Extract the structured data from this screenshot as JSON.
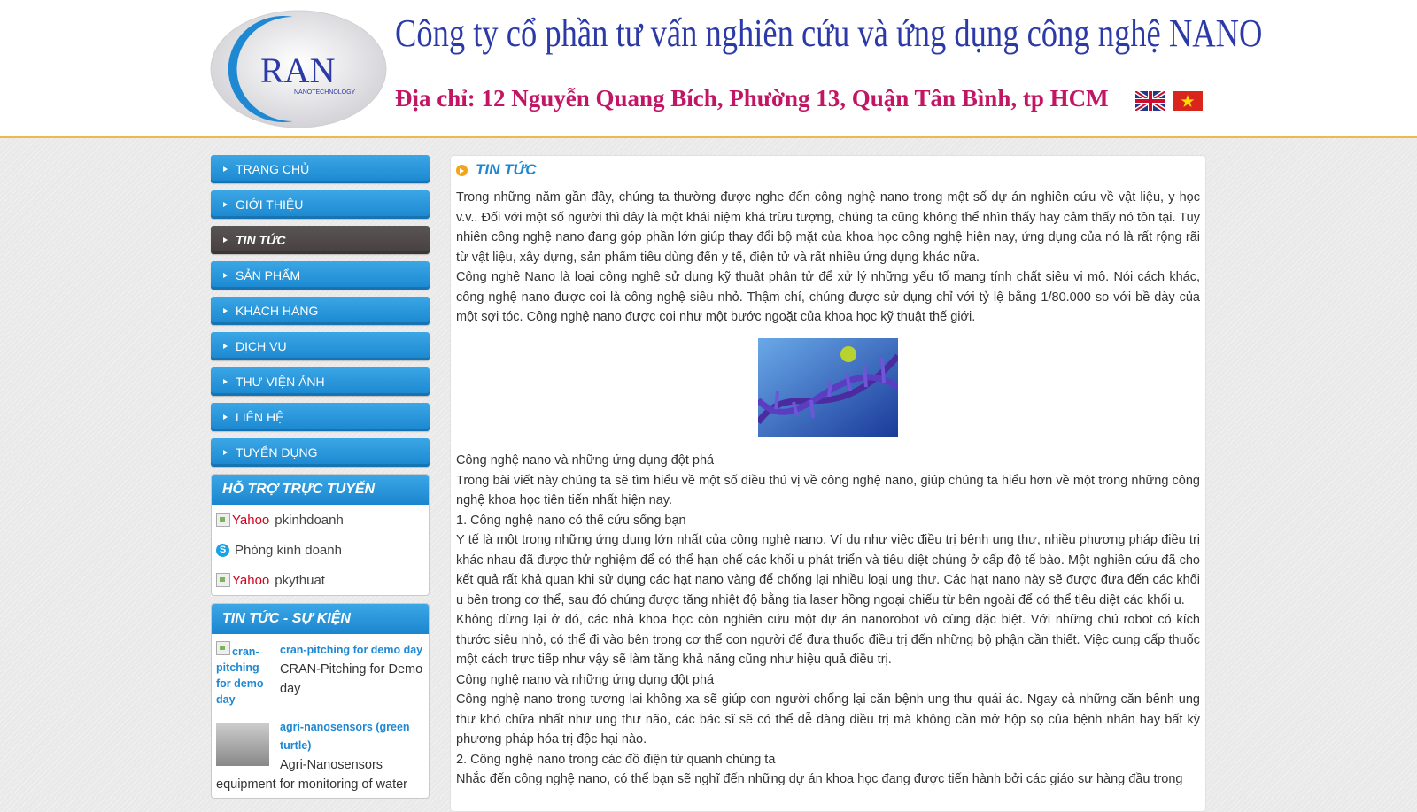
{
  "header": {
    "logo_text": "RAN",
    "logo_subtext": "NANOTECHNOLOGY",
    "company_name": "Công ty cổ phần tư vấn nghiên cứu và ứng dụng công nghệ NANO",
    "address": "Địa chỉ: 12 Nguyễn Quang Bích, Phường 13, Quận Tân Bình, tp HCM",
    "flags": [
      "uk-flag-icon",
      "vn-flag-icon"
    ]
  },
  "menu": {
    "items": [
      {
        "label": "TRANG CHỦ"
      },
      {
        "label": "GIỚI THIỆU"
      },
      {
        "label": "TIN TỨC"
      },
      {
        "label": "SẢN PHẨM"
      },
      {
        "label": "KHÁCH HÀNG"
      },
      {
        "label": "DỊCH VỤ"
      },
      {
        "label": "THƯ VIỆN ẢNH"
      },
      {
        "label": "LIÊN HỆ"
      },
      {
        "label": "TUYỂN DỤNG"
      }
    ],
    "active": "TIN TỨC"
  },
  "support": {
    "title": "HỖ TRỢ TRỰC TUYẾN",
    "rows": [
      {
        "alt": "Yahoo",
        "name": "pkinhdoanh"
      },
      {
        "alt": "",
        "name": "Phòng kinh doanh"
      },
      {
        "alt": "Yahoo",
        "name": "pkythuat"
      }
    ]
  },
  "news_box": {
    "title": "TIN TỨC - SỰ KIỆN",
    "items": [
      {
        "thumb_alt": "cran-pitching for demo day",
        "link": "cran-pitching for demo day",
        "desc": "CRAN-Pitching for Demo day"
      },
      {
        "thumb_alt": "",
        "link": "agri-nanosensors (green turtle)",
        "desc": "Agri-Nanosensors equipment for monitoring of water"
      }
    ]
  },
  "content": {
    "title": "TIN TỨC",
    "paragraphs_top": [
      "Trong những năm gần đây, chúng ta thường được nghe đến công nghệ nano trong một số dự án nghiên cứu về vật liệu, y học v.v.. Đối với một số người thì đây là một khái niệm khá trừu tượng, chúng ta cũng không thể nhìn thấy hay cảm thấy nó tồn tại. Tuy nhiên công nghệ nano đang góp phần lớn giúp thay đổi bộ mặt của khoa học công nghệ hiện nay, ứng dụng của nó là rất rộng rãi từ vật liệu, xây dựng, sản phẩm tiêu dùng đến y tế, điện tử và rất nhiều ứng dụng khác nữa.",
      "Công nghệ Nano là loại công nghệ sử dụng kỹ thuật phân tử để xử lý những yếu tố mang tính chất siêu vi mô. Nói cách khác, công nghệ nano được coi là công nghệ siêu nhỏ. Thậm chí, chúng được sử dụng chỉ với tỷ lệ bằng 1/80.000 so với bề dày của một sợi tóc. Công nghệ nano được coi như một bước ngoặt của khoa học kỹ thuật thế giới."
    ],
    "paragraphs_bottom": [
      "Công nghệ nano và những ứng dụng đột phá",
      "Trong bài viết này chúng ta sẽ tìm hiểu về một số điều thú vị về công nghệ nano, giúp chúng ta hiểu hơn về một trong những công nghệ khoa học tiên tiến nhất hiện nay.",
      "1. Công nghệ nano có thể cứu sống bạn",
      "Y tế là một trong những ứng dụng lớn nhất của công nghệ nano. Ví dụ như việc điều trị bệnh ung thư, nhiều phương pháp điều trị khác nhau đã được thử nghiệm để có thể hạn chế các khối u phát triển và tiêu diệt chúng ở cấp độ tế bào. Một nghiên cứu đã cho kết quả rất khả quan khi sử dụng các hạt nano vàng để chống lại nhiều loại ung thư. Các hạt nano này sẽ được đưa đến các khối u bên trong cơ thể, sau đó chúng được tăng nhiệt độ bằng tia laser hồng ngoại chiếu từ bên ngoài để có thể tiêu diệt các khối u.",
      "Không dừng lại ở đó, các nhà khoa học còn nghiên cứu một dự án nanorobot vô cùng đặc biệt. Với những chú robot có kích thước siêu nhỏ, có thể đi vào bên trong cơ thể con người để đưa thuốc điều trị đến những bộ phận cần thiết. Việc cung cấp thuốc một cách trực tiếp như vậy sẽ làm tăng khả năng cũng như hiệu quả điều trị.",
      "Công nghệ nano và những ứng dụng đột phá",
      "Công nghệ nano trong tương lai không xa sẽ giúp con người chống lại căn bệnh ung thư quái ác. Ngay cả những căn bênh ung thư khó chữa nhất như ung thư não, các bác sĩ sẽ có thể dễ dàng điều trị mà không cần mở hộp sọ của bệnh nhân hay bất kỳ phương pháp hóa trị độc hại nào.",
      "2. Công nghệ nano trong các đồ điện tử quanh chúng ta",
      "Nhắc đến công nghệ nano, có thể bạn sẽ nghĩ đến những dự án khoa học đang được tiến hành bởi các giáo sư hàng đầu trong"
    ]
  },
  "colors": {
    "menu_blue": "#1b86cf",
    "menu_active": "#463f3f",
    "title_blue": "#1e88d3",
    "company_blue": "#2c3aa8",
    "address_magenta": "#c21563",
    "header_border": "#f0b84a"
  }
}
